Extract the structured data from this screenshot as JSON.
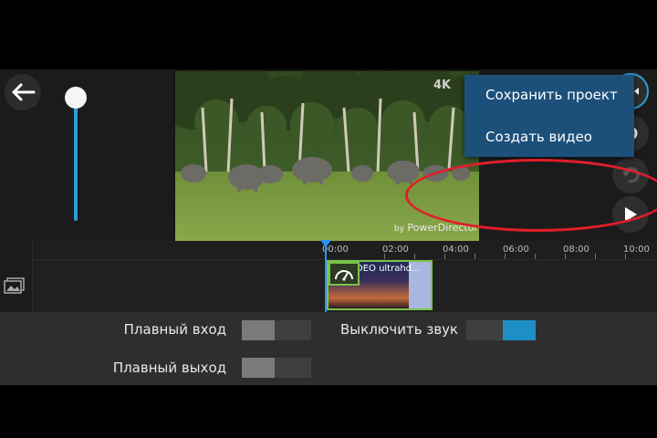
{
  "preview": {
    "resolution_badge": "4K",
    "watermark_prefix": "by",
    "watermark_brand": "PowerDirector"
  },
  "menu": {
    "items": [
      {
        "label": "Сохранить проект"
      },
      {
        "label": "Создать видео"
      }
    ]
  },
  "timeline": {
    "ticks": [
      "00:00",
      "02:00",
      "04:00",
      "06:00",
      "08:00",
      "10:00"
    ],
    "clip_title": "DEO ultrahd..."
  },
  "options": {
    "fade_in_label": "Плавный вход",
    "fade_out_label": "Плавный выход",
    "mute_label": "Выключить звук",
    "fade_in_on": false,
    "fade_out_on": false,
    "mute_on": true
  },
  "colors": {
    "accent_blue": "#29a0d6",
    "menu_bg": "#1c4f7a",
    "highlight_red": "#e01e2a",
    "clip_border": "#7cc24a"
  },
  "icons": {
    "back": "arrow-left-icon",
    "play": "play-icon",
    "undo": "undo-icon",
    "settings": "gear-icon",
    "export": "film-export-icon",
    "track": "image-track-icon",
    "speed": "speedometer-icon"
  }
}
